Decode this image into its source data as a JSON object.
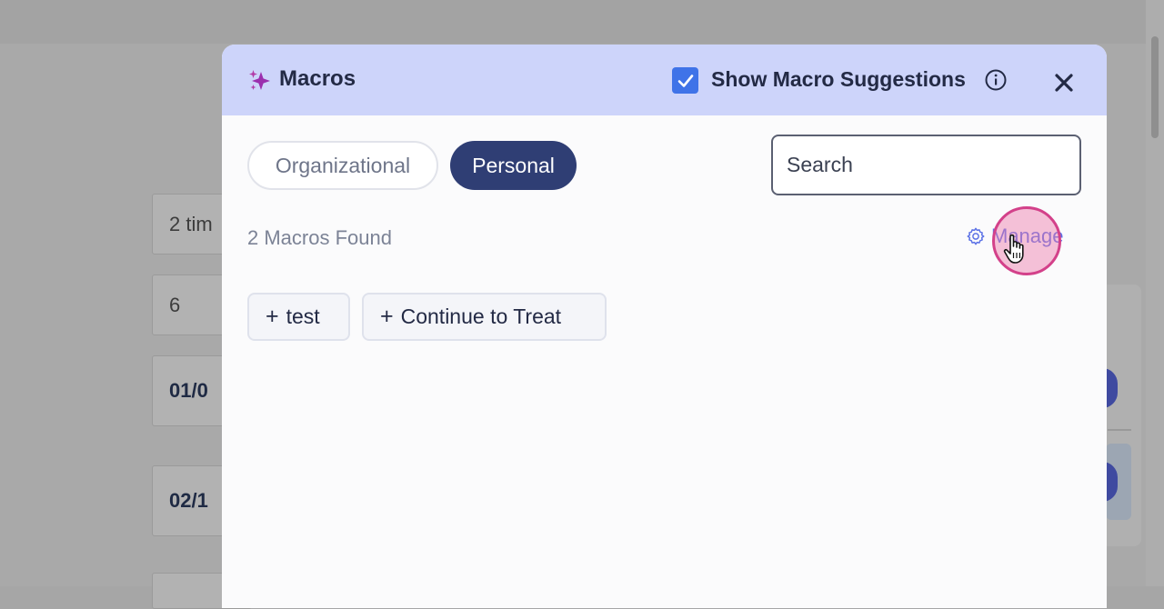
{
  "background": {
    "fields": [
      "2 tim",
      "6",
      "01/0",
      "02/1"
    ]
  },
  "modal": {
    "title": "Macros",
    "show_suggestions_label": "Show Macro Suggestions",
    "show_suggestions_checked": true,
    "tabs": [
      {
        "label": "Organizational",
        "active": false
      },
      {
        "label": "Personal",
        "active": true
      }
    ],
    "search": {
      "placeholder": "Search",
      "value": ""
    },
    "count_text": "2 Macros Found",
    "manage_label": "Manage",
    "macros": [
      {
        "label": "test",
        "prefix": "+"
      },
      {
        "label": "Continue to Treat",
        "prefix": "+"
      }
    ]
  },
  "colors": {
    "header_bg": "#cdd4fa",
    "active_tab": "#2f3e74",
    "accent": "#5c72e6",
    "checkbox": "#3f73e8",
    "sparkle": "#9b2fae",
    "click_ring": "#d3418a"
  },
  "icons": [
    "sparkle-icon",
    "checkbox-checked-icon",
    "info-icon",
    "close-icon",
    "gear-icon",
    "pointer-hand-icon"
  ]
}
